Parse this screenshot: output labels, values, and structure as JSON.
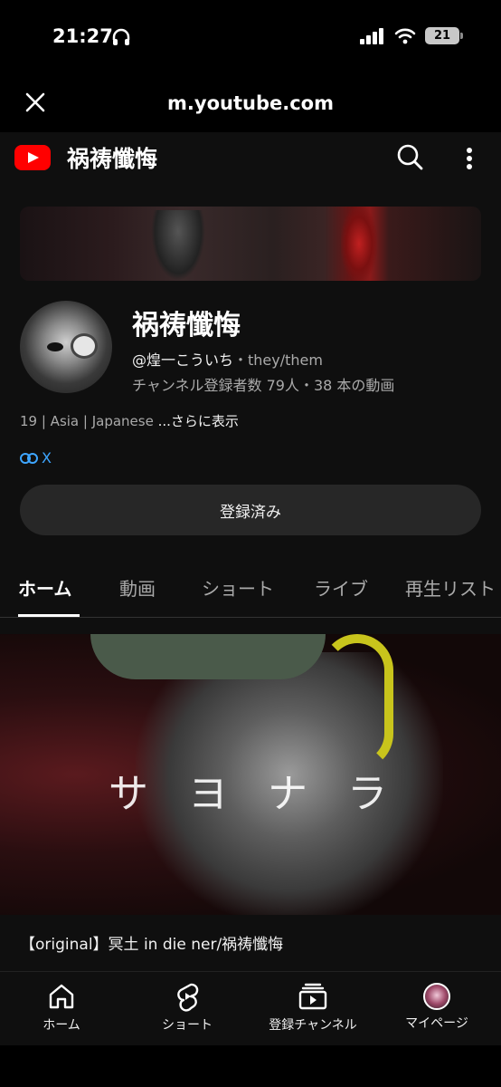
{
  "status": {
    "time": "21:27",
    "battery": "21"
  },
  "browser": {
    "url": "m.youtube.com"
  },
  "header": {
    "title": "祸祷懺悔"
  },
  "channel": {
    "name": "祸祷懺悔",
    "handle": "@煌一こういち",
    "pronouns": "・they/them",
    "stats": "チャンネル登録者数 79人・38 本の動画",
    "description": "19 | Asia | Japanese",
    "more": "...さらに表示",
    "link": "X",
    "subscribe_label": "登録済み"
  },
  "tabs": [
    {
      "label": "ホーム"
    },
    {
      "label": "動画"
    },
    {
      "label": "ショート"
    },
    {
      "label": "ライブ"
    },
    {
      "label": "再生リスト"
    }
  ],
  "video": {
    "thumb_text": "サヨナラ",
    "title": "【original】冥土 in die ner/祸祷懺悔"
  },
  "bottom_nav": [
    {
      "label": "ホーム"
    },
    {
      "label": "ショート"
    },
    {
      "label": "登録チャンネル"
    },
    {
      "label": "マイページ"
    }
  ],
  "colors": {
    "background": "#0f0f0f",
    "accent": "#ff0000",
    "link": "#3ea6ff"
  }
}
